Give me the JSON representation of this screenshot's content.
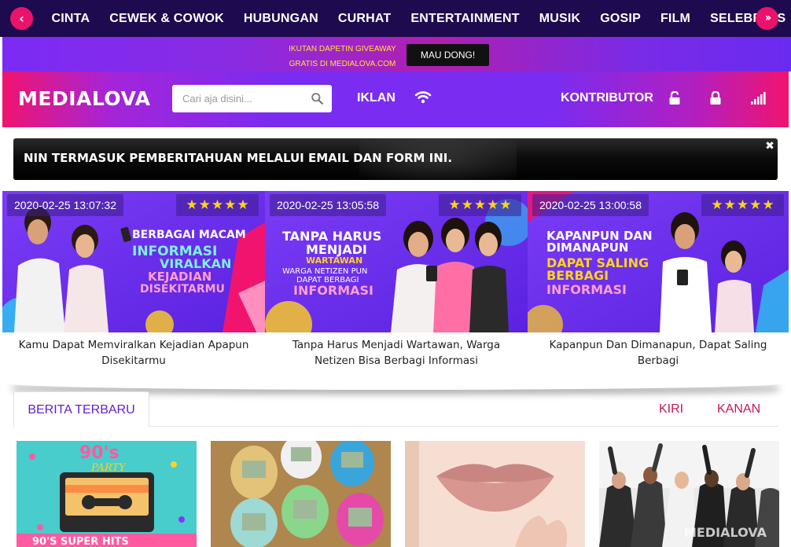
{
  "nav": {
    "items": [
      "CINTA",
      "CEWEK & COWOK",
      "HUBUNGAN",
      "CURHAT",
      "ENTERTAINMENT",
      "MUSIK",
      "GOSIP",
      "FILM",
      "SELEBRITIS"
    ]
  },
  "promo": {
    "line1": "IKUTAN DAPETIN GIVEAWAY",
    "line2": "GRATIS DI MEDIALOVA.COM",
    "button": "MAU DONG!"
  },
  "header": {
    "logo": "MEDIALOVA",
    "search_placeholder": "Cari aja disini...",
    "iklan": "IKLAN",
    "kontributor": "KONTRIBUTOR"
  },
  "notice": {
    "text": "NIN TERMASUK PEMBERITAHUAN MELALUI EMAIL DAN FORM INI.",
    "close": "✖"
  },
  "featured": [
    {
      "date": "2020-02-25 13:07:32",
      "rating": 5,
      "title": "Kamu Dapat Memviralkan Kejadian Apapun Disekitarmu",
      "banner_lines": [
        "BERBAGAI MACAM",
        "INFORMASI",
        "VIRALKAN",
        "KEJADIAN",
        "DISEKITARMU"
      ]
    },
    {
      "date": "2020-02-25 13:05:58",
      "rating": 5,
      "title": "Tanpa Harus Menjadi Wartawan, Warga Netizen Bisa Berbagi Informasi",
      "banner_lines": [
        "TANPA HARUS",
        "MENJADI",
        "WARTAWAN",
        "WARGA NETIZEN PUN",
        "DAPAT BERBAGI",
        "INFORMASI"
      ]
    },
    {
      "date": "2020-02-25 13:00:58",
      "rating": 5,
      "title": "Kapanpun Dan Dimanapun, Dapat Saling Berbagi",
      "banner_lines": [
        "KAPANPUN DAN",
        "DIMANAPUN",
        "DAPAT SALING",
        "BERBAGI",
        "INFORMASI"
      ]
    }
  ],
  "tabs": {
    "active": "BERITA TERBARU",
    "left": "KIRI",
    "right": "KANAN"
  },
  "thumbnails": {
    "t1_text1": "90's",
    "t1_text2": "PARTY",
    "t1_text3": "90'S SUPER HITS",
    "t4_watermark": "MEDIALOVA"
  },
  "colors": {
    "nav_bg": "#1e0a4f",
    "accent_pink": "#e9136b",
    "purple": "#7a2cf0",
    "tab_active": "#6420d0",
    "tab_link": "#c2185b",
    "star": "#ffd21f"
  }
}
